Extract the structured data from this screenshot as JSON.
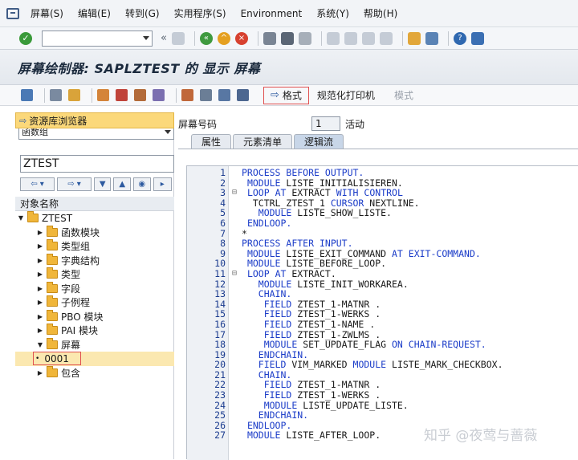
{
  "menu": [
    "屏幕(S)",
    "编辑(E)",
    "转到(G)",
    "实用程序(S)",
    "Environment",
    "系统(Y)",
    "帮助(H)"
  ],
  "title": "屏幕绘制器: SAPLZTEST 的 显示 屏幕",
  "app_toolbar": {
    "format_label": "格式",
    "normalized_print_label": "规范化打印机",
    "mode_label": "模式"
  },
  "left": {
    "repo_browser_label": "资源库浏览器",
    "object_type": "函数组",
    "object_name_value": "ZTEST",
    "tree_header": "对象名称",
    "root": "ZTEST",
    "nodes": [
      "函数模块",
      "类型组",
      "字典结构",
      "类型",
      "字段",
      "子例程",
      "PBO 模块",
      "PAI 模块",
      "屏幕"
    ],
    "screen_child": "0001",
    "last_node": "包含"
  },
  "right": {
    "screen_no_label": "屏幕号码",
    "screen_no_value": "1",
    "status": "活动",
    "tabs": [
      "属性",
      "元素清单",
      "逻辑流"
    ]
  },
  "code_lines": [
    {
      "n": "1",
      "t": "PROCESS BEFORE OUTPUT."
    },
    {
      "n": "2",
      "t": " MODULE LISTE_INITIALISIEREN."
    },
    {
      "n": "3",
      "t": " LOOP AT EXTRACT WITH CONTROL",
      "fold": "⊟"
    },
    {
      "n": "4",
      "t": "  TCTRL_ZTEST_1 CURSOR NEXTLINE."
    },
    {
      "n": "5",
      "t": "   MODULE LISTE_SHOW_LISTE."
    },
    {
      "n": "6",
      "t": " ENDLOOP."
    },
    {
      "n": "7",
      "t": "*"
    },
    {
      "n": "8",
      "t": "PROCESS AFTER INPUT."
    },
    {
      "n": "9",
      "t": " MODULE LISTE_EXIT_COMMAND AT EXIT-COMMAND."
    },
    {
      "n": "10",
      "t": " MODULE LISTE_BEFORE_LOOP."
    },
    {
      "n": "11",
      "t": " LOOP AT EXTRACT.",
      "fold": "⊟"
    },
    {
      "n": "12",
      "t": "   MODULE LISTE_INIT_WORKAREA."
    },
    {
      "n": "13",
      "t": "   CHAIN."
    },
    {
      "n": "14",
      "t": "    FIELD ZTEST_1-MATNR ."
    },
    {
      "n": "15",
      "t": "    FIELD ZTEST_1-WERKS ."
    },
    {
      "n": "16",
      "t": "    FIELD ZTEST_1-NAME ."
    },
    {
      "n": "17",
      "t": "    FIELD ZTEST_1-ZWLMS ."
    },
    {
      "n": "18",
      "t": "    MODULE SET_UPDATE_FLAG ON CHAIN-REQUEST."
    },
    {
      "n": "19",
      "t": "   ENDCHAIN."
    },
    {
      "n": "20",
      "t": "   FIELD VIM_MARKED MODULE LISTE_MARK_CHECKBOX."
    },
    {
      "n": "21",
      "t": "   CHAIN."
    },
    {
      "n": "22",
      "t": "    FIELD ZTEST_1-MATNR ."
    },
    {
      "n": "23",
      "t": "    FIELD ZTEST_1-WERKS ."
    },
    {
      "n": "24",
      "t": "    MODULE LISTE_UPDATE_LISTE."
    },
    {
      "n": "25",
      "t": "   ENDCHAIN."
    },
    {
      "n": "26",
      "t": " ENDLOOP."
    },
    {
      "n": "27",
      "t": " MODULE LISTE_AFTER_LOOP."
    }
  ],
  "watermark": "知乎 @夜莺与蔷薇",
  "colors": {
    "keyword": "#1b3cc8",
    "line_number": "#1b3c8f",
    "selection": "#fbe8b0",
    "highlight_border": "#e05050"
  }
}
